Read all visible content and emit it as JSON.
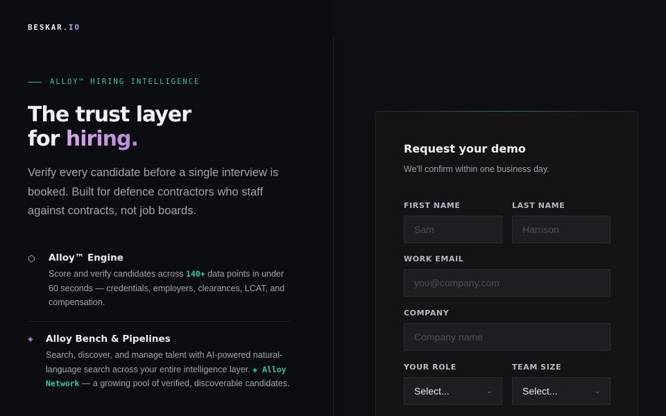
{
  "brand": {
    "name_main": "BESKAR",
    "name_accent": ".IO"
  },
  "hero": {
    "eyebrow": "ALLOY™ HIRING INTELLIGENCE",
    "headline_line1": "The trust layer",
    "headline_for": "for ",
    "headline_highlight": "hiring.",
    "lead": "Verify every candidate before a single interview is booked. Built for defence contractors who staff against contracts, not job boards."
  },
  "features": [
    {
      "icon": "hexagon-icon",
      "title": "Alloy™ Engine",
      "desc_before": "Score and verify candidates across ",
      "desc_highlight": "140+",
      "desc_after": " data points in under 60 seconds — credentials, employers, clearances, LCAT, and compensation."
    },
    {
      "icon": "diamond-icon",
      "title": "Alloy Bench & Pipelines",
      "desc_before": "Search, discover, and manage talent with AI-powered natural-language search across your entire intelligence layer. ",
      "desc_highlight": "◈ Alloy Network",
      "desc_after": " — a growing pool of verified, discoverable candidates."
    }
  ],
  "form": {
    "title": "Request your demo",
    "subtitle": "We'll confirm within one business day.",
    "first_name": {
      "label": "FIRST NAME",
      "placeholder": "Sam",
      "value": ""
    },
    "last_name": {
      "label": "LAST NAME",
      "placeholder": "Harrison",
      "value": ""
    },
    "email": {
      "label": "WORK EMAIL",
      "placeholder": "you@company.com",
      "value": ""
    },
    "company": {
      "label": "COMPANY",
      "placeholder": "Company name",
      "value": ""
    },
    "role": {
      "label": "YOUR ROLE",
      "selected": "Select..."
    },
    "team_size": {
      "label": "TEAM SIZE",
      "selected": "Select..."
    }
  },
  "colors": {
    "background": "#0c0d10",
    "accent_teal": "#35c4a0",
    "accent_purple": "#c79ee6",
    "card": "#141417",
    "input": "#1d1e22"
  }
}
